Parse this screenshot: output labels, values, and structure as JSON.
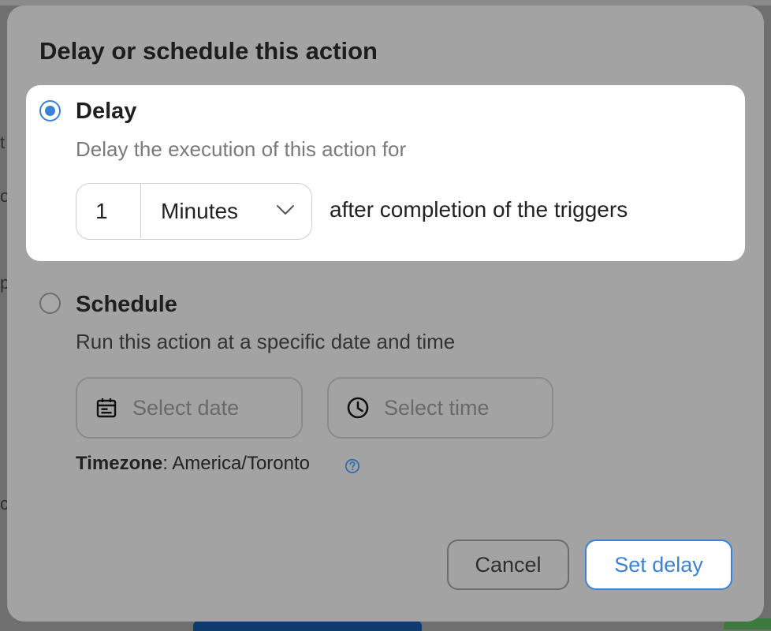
{
  "dialog": {
    "title": "Delay or schedule this action",
    "delay": {
      "label": "Delay",
      "description": "Delay the execution of this action for",
      "amount": "1",
      "unit": "Minutes",
      "suffix": "after completion of the triggers",
      "selected": true
    },
    "schedule": {
      "label": "Schedule",
      "description": "Run this action at a specific date and time",
      "date_placeholder": "Select date",
      "time_placeholder": "Select time",
      "selected": false
    },
    "timezone": {
      "label": "Timezone",
      "value": "America/Toronto"
    },
    "buttons": {
      "cancel": "Cancel",
      "submit": "Set delay"
    }
  },
  "background": {
    "fragments": [
      "t",
      "o",
      "p",
      "c"
    ]
  },
  "colors": {
    "accent": "#3b82d6",
    "overlay": "#a3a3a3"
  }
}
